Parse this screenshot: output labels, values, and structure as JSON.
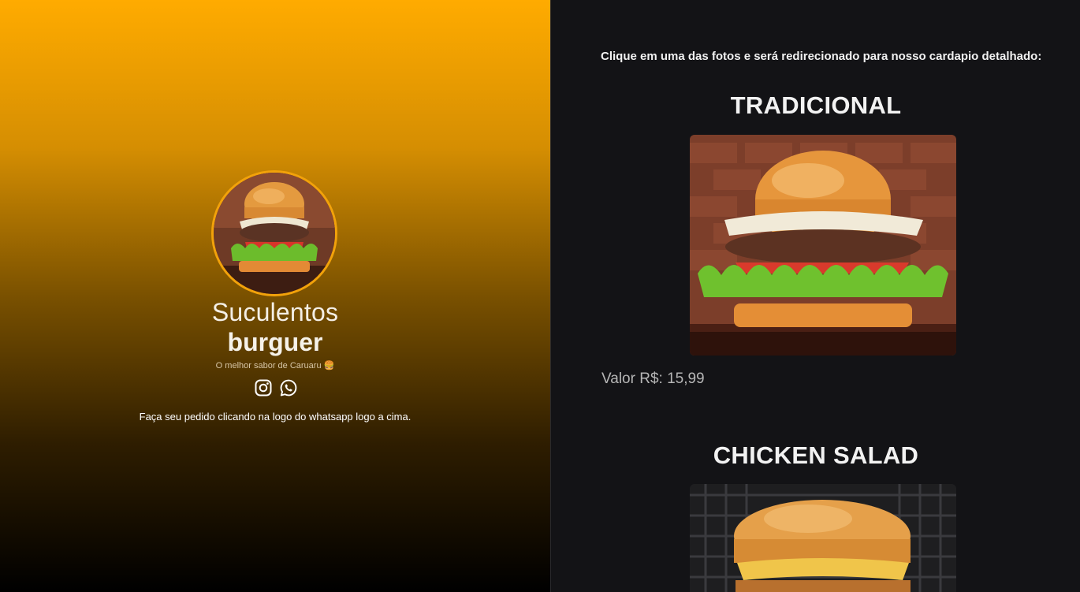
{
  "profile": {
    "name_line1": "Suculentos",
    "name_line2": "burguer",
    "tagline": "O melhor sabor de Caruaru 🍔",
    "social_icons": [
      "instagram-icon",
      "whatsapp-icon"
    ],
    "order_instruction": "Faça seu pedido clicando na logo do whatsapp logo a cima."
  },
  "menu": {
    "intro": "Clique em uma das fotos e será redirecionado para nosso cardapio detalhado:",
    "items": [
      {
        "title": "TRADICIONAL",
        "price": "Valor R$: 15,99"
      },
      {
        "title": "CHICKEN SALAD"
      }
    ]
  },
  "colors": {
    "accent_orange": "#ffab00",
    "dark_bg": "#131316",
    "light_text": "#f2f2f2",
    "price_text": "#b6b6b6"
  }
}
